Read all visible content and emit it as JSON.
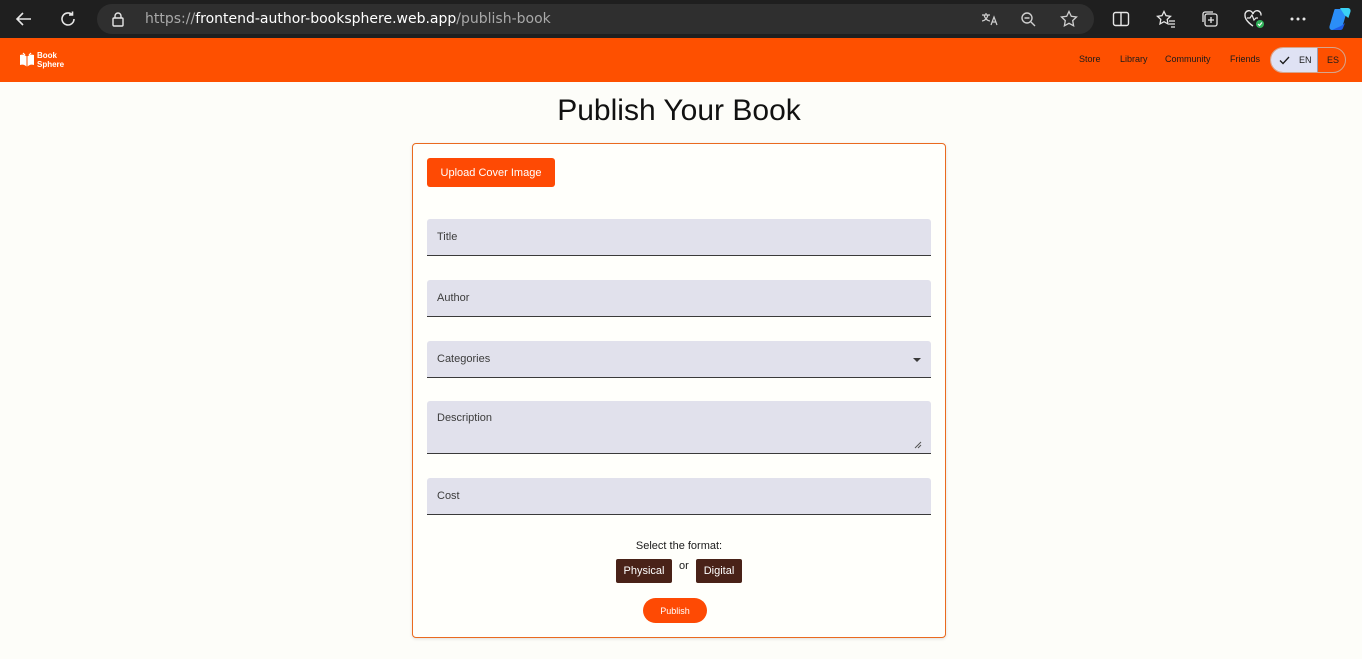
{
  "browser": {
    "url_scheme": "https://",
    "url_host": "frontend-author-booksphere.web.app",
    "url_path": "/publish-book"
  },
  "header": {
    "logo_line1": "Book",
    "logo_line2": "Sphere",
    "nav": {
      "store": "Store",
      "library": "Library",
      "community": "Community",
      "friends": "Friends"
    },
    "lang": {
      "en": "EN",
      "es": "ES",
      "selected": "EN"
    }
  },
  "page": {
    "title": "Publish Your Book",
    "upload_label": "Upload Cover Image",
    "fields": {
      "title": "Title",
      "author": "Author",
      "categories": "Categories",
      "description": "Description",
      "cost": "Cost"
    },
    "format_label": "Select the format:",
    "format_physical": "Physical",
    "format_or": "or",
    "format_digital": "Digital",
    "publish_label": "Publish"
  },
  "colors": {
    "brand": "#fe5000",
    "button": "#fe4a04",
    "format_button": "#492218",
    "field_bg": "#e1e1ec"
  }
}
